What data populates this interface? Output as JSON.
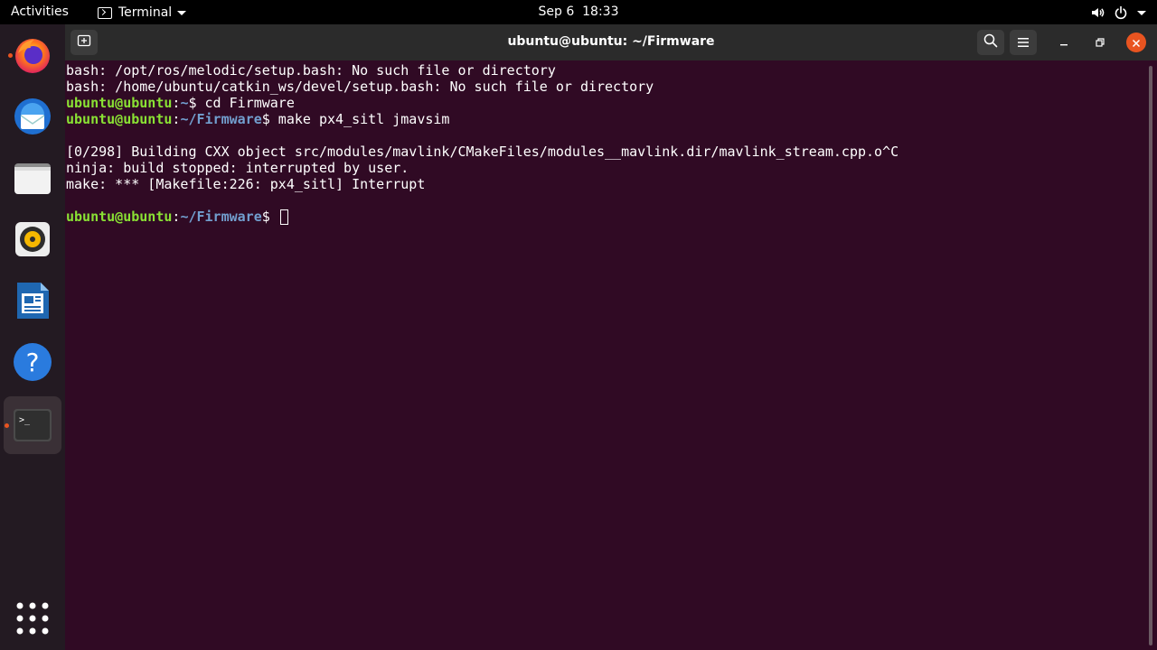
{
  "topbar": {
    "activities_label": "Activities",
    "app_menu_label": "Terminal",
    "date": "Sep 6",
    "time": "18:33",
    "icons": [
      "volume-icon",
      "power-icon",
      "chevron-down-icon"
    ]
  },
  "dock": {
    "items": [
      {
        "name": "firefox",
        "running": true,
        "active": false
      },
      {
        "name": "thunderbird",
        "running": false,
        "active": false
      },
      {
        "name": "files",
        "running": false,
        "active": false
      },
      {
        "name": "rhythmbox",
        "running": false,
        "active": false
      },
      {
        "name": "libreoffice-writer",
        "running": false,
        "active": false
      },
      {
        "name": "help",
        "running": false,
        "active": false
      },
      {
        "name": "terminal",
        "running": true,
        "active": true
      },
      {
        "name": "show-applications",
        "running": false,
        "active": false
      }
    ]
  },
  "window": {
    "title": "ubuntu@ubuntu: ~/Firmware"
  },
  "terminal": {
    "lines": [
      {
        "text": "bash: /opt/ros/melodic/setup.bash: No such file or directory"
      },
      {
        "text": "bash: /home/ubuntu/catkin_ws/devel/setup.bash: No such file or directory"
      },
      {
        "user": "ubuntu@ubuntu",
        "path": "~",
        "command": " cd Firmware"
      },
      {
        "user": "ubuntu@ubuntu",
        "path": "~/Firmware",
        "command": " make px4_sitl jmavsim"
      },
      {
        "text": ""
      },
      {
        "text": "[0/298] Building CXX object src/modules/mavlink/CMakeFiles/modules__mavlink.dir/mavlink_stream.cpp.o^C"
      },
      {
        "text": "ninja: build stopped: interrupted by user."
      },
      {
        "text": "make: *** [Makefile:226: px4_sitl] Interrupt"
      },
      {
        "text": ""
      },
      {
        "user": "ubuntu@ubuntu",
        "path": "~/Firmware",
        "command": " ",
        "cursor": true
      }
    ]
  },
  "colors": {
    "terminal_bg": "#300a24",
    "prompt_user": "#8ae234",
    "prompt_path": "#729fcf",
    "accent": "#e95420"
  }
}
